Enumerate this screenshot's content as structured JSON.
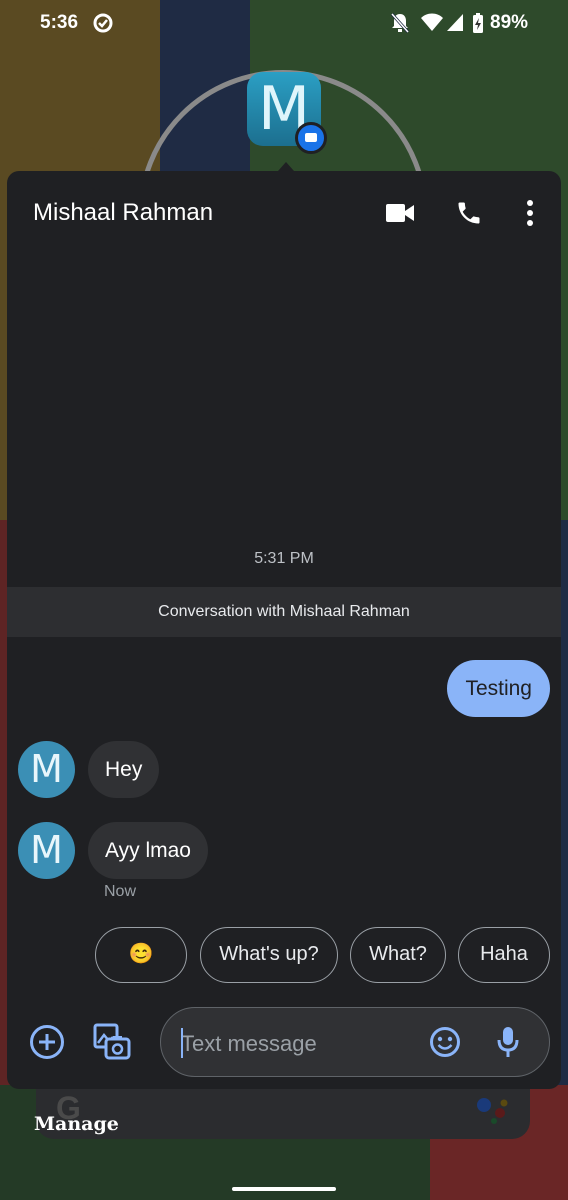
{
  "status_bar": {
    "time": "5:36",
    "battery": "89%"
  },
  "bubble": {
    "letter": "M"
  },
  "header": {
    "contact_name": "Mishaal Rahman"
  },
  "conversation": {
    "timestamp": "5:31 PM",
    "banner": "Conversation with Mishaal Rahman",
    "messages": [
      {
        "direction": "outgoing",
        "text": "Testing"
      },
      {
        "direction": "incoming",
        "avatar": "M",
        "text": "Hey"
      },
      {
        "direction": "incoming",
        "avatar": "M",
        "text": "Ayy lmao",
        "status": "Now"
      }
    ]
  },
  "smart_replies": [
    "😊",
    "What's up?",
    "What?",
    "Haha"
  ],
  "compose": {
    "placeholder": "Text message"
  },
  "widget": {
    "manage_label": "Manage",
    "google_letter": "G"
  },
  "colors": {
    "panel_bg": "#1f2023",
    "outgoing_bubble": "#8ab4f8",
    "incoming_bubble": "#303134",
    "avatar": "#3b8fb5",
    "accent": "#8ab4f8"
  }
}
